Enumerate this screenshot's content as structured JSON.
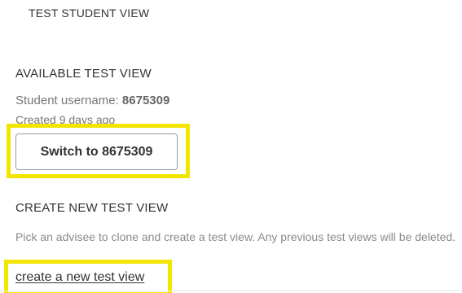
{
  "page": {
    "title": "TEST STUDENT VIEW"
  },
  "available": {
    "heading": "AVAILABLE TEST VIEW",
    "username_label": "Student username: ",
    "username_value": "8675309",
    "created": "Created 9 days ago",
    "switch_button_label": "Switch to 8675309"
  },
  "create": {
    "heading": "CREATE NEW TEST VIEW",
    "description": "Pick an advisee to clone and create a test view. Any previous test views will be deleted.",
    "link_label": "create a new test view"
  },
  "colors": {
    "highlight": "#f2e600",
    "text": "#333333",
    "muted_text": "#8a8a8a"
  }
}
